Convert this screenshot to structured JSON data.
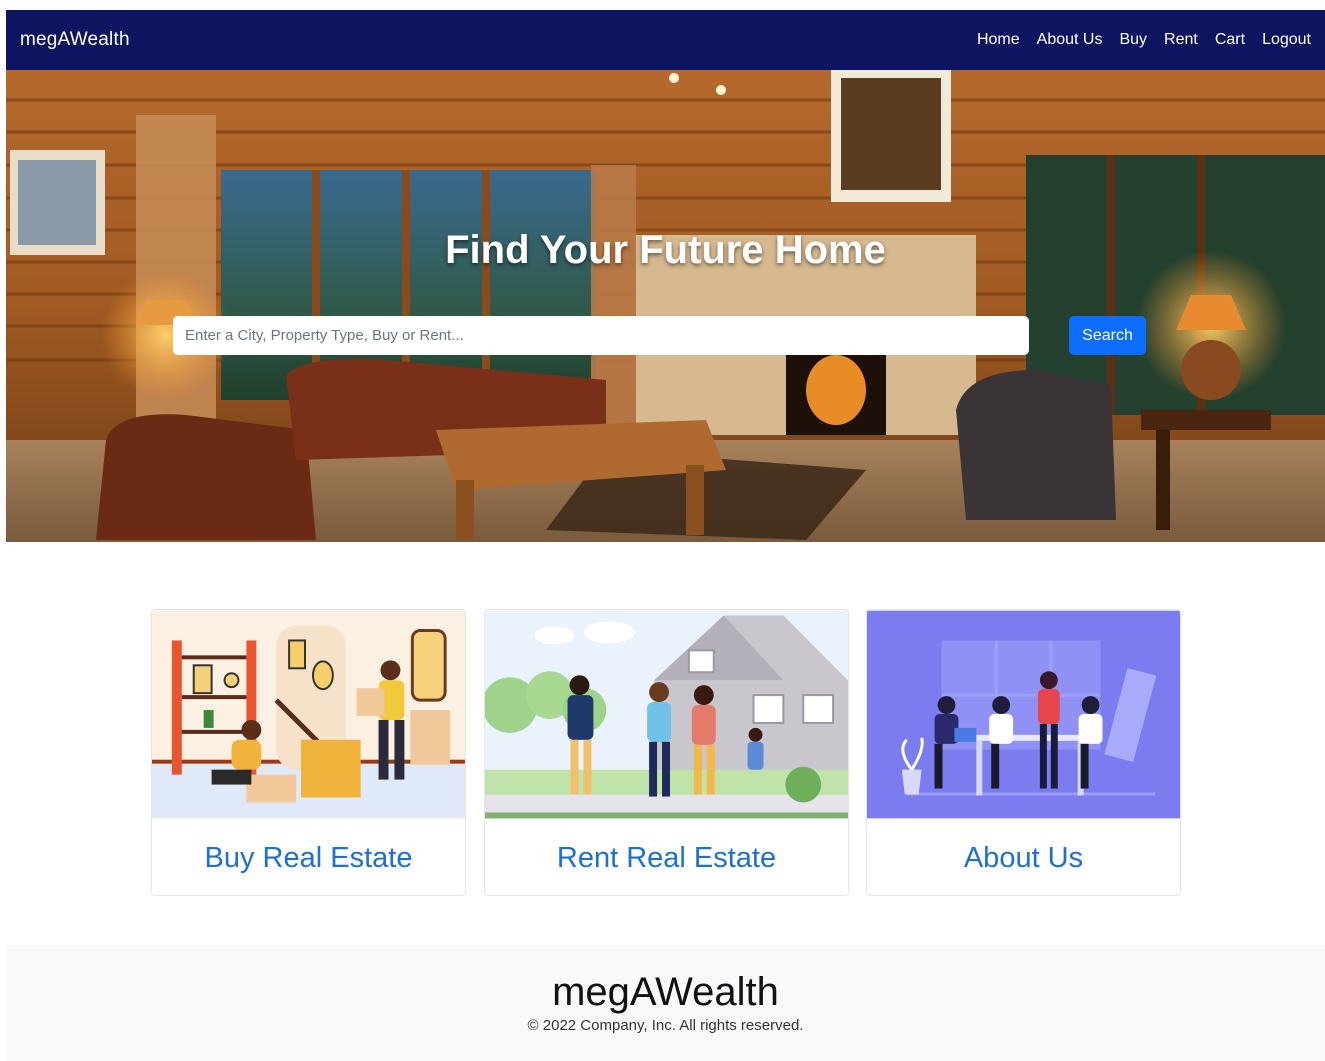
{
  "nav": {
    "brand": "megAWealth",
    "links": [
      "Home",
      "About Us",
      "Buy",
      "Rent",
      "Cart",
      "Logout"
    ]
  },
  "hero": {
    "title": "Find Your Future Home",
    "search_placeholder": "Enter a City, Property Type, Buy or Rent...",
    "search_button": "Search"
  },
  "cards": [
    {
      "title": "Buy Real Estate"
    },
    {
      "title": "Rent Real Estate"
    },
    {
      "title": "About Us"
    }
  ],
  "footer": {
    "brand": "megAWealth",
    "copyright": "© 2022 Company, Inc. All rights reserved."
  },
  "colors": {
    "navbar": "#0d1460",
    "primary": "#0d6efd",
    "card_title": "#1d6fd8",
    "footer_bg": "#f8f9fa"
  }
}
